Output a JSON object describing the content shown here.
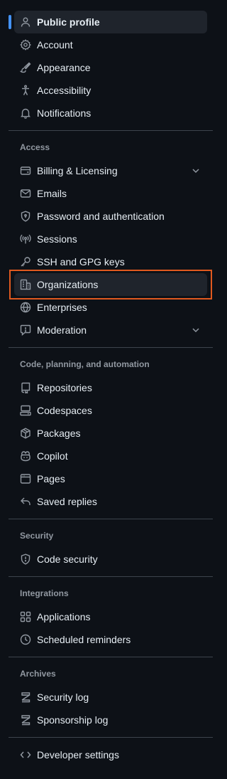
{
  "sections": [
    {
      "heading": "",
      "items": [
        {
          "label": "Public profile",
          "icon": "person-icon",
          "selected": true
        },
        {
          "label": "Account",
          "icon": "gear-icon"
        },
        {
          "label": "Appearance",
          "icon": "paintbrush-icon"
        },
        {
          "label": "Accessibility",
          "icon": "accessibility-icon"
        },
        {
          "label": "Notifications",
          "icon": "bell-icon"
        }
      ]
    },
    {
      "heading": "Access",
      "items": [
        {
          "label": "Billing & Licensing",
          "icon": "credit-card-icon",
          "expandable": true
        },
        {
          "label": "Emails",
          "icon": "mail-icon"
        },
        {
          "label": "Password and authentication",
          "icon": "shield-lock-icon"
        },
        {
          "label": "Sessions",
          "icon": "broadcast-icon"
        },
        {
          "label": "SSH and GPG keys",
          "icon": "key-icon"
        },
        {
          "label": "Organizations",
          "icon": "organization-icon",
          "highlighted": true
        },
        {
          "label": "Enterprises",
          "icon": "globe-icon"
        },
        {
          "label": "Moderation",
          "icon": "report-icon",
          "expandable": true
        }
      ]
    },
    {
      "heading": "Code, planning, and automation",
      "items": [
        {
          "label": "Repositories",
          "icon": "repo-icon"
        },
        {
          "label": "Codespaces",
          "icon": "codespaces-icon"
        },
        {
          "label": "Packages",
          "icon": "package-icon"
        },
        {
          "label": "Copilot",
          "icon": "copilot-icon"
        },
        {
          "label": "Pages",
          "icon": "browser-icon"
        },
        {
          "label": "Saved replies",
          "icon": "reply-icon"
        }
      ]
    },
    {
      "heading": "Security",
      "items": [
        {
          "label": "Code security",
          "icon": "shield-check-icon"
        }
      ]
    },
    {
      "heading": "Integrations",
      "items": [
        {
          "label": "Applications",
          "icon": "apps-icon"
        },
        {
          "label": "Scheduled reminders",
          "icon": "clock-icon"
        }
      ]
    },
    {
      "heading": "Archives",
      "items": [
        {
          "label": "Security log",
          "icon": "log-icon"
        },
        {
          "label": "Sponsorship log",
          "icon": "log-icon"
        }
      ]
    },
    {
      "heading": "",
      "items": [
        {
          "label": "Developer settings",
          "icon": "code-icon"
        }
      ]
    }
  ],
  "colors": {
    "background": "#0d1117",
    "selected_bar": "#4493f8",
    "highlight_border": "#e0591f"
  }
}
